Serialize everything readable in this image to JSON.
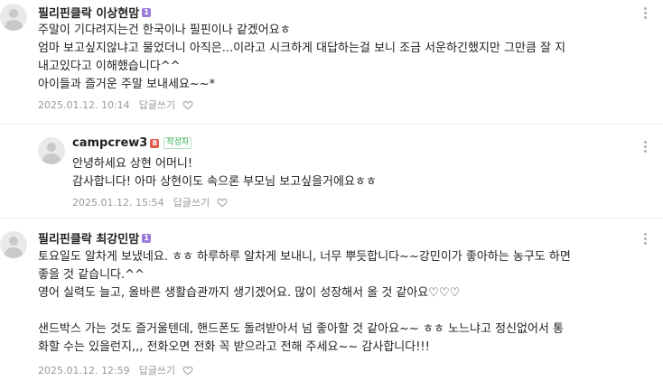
{
  "comments": [
    {
      "author": "필리핀클락 이상현맘",
      "level": "1",
      "text": "주말이 기다려지는건 한국이나 필핀이나 같겠어요ㅎ\n엄마 보고싶지않냐고 물었더니 아직은...이라고 시크하게 대답하는걸 보니 조금 서운하긴했지만 그만큼 잘 지\n내고있다고 이해했습니다^^\n아이들과 즐거운 주말 보내세요~~*",
      "date": "2025.01.12. 10:14",
      "reply_label": "답글쓰기"
    },
    {
      "author": "campcrew3",
      "level": "8",
      "writer_badge": "작성자",
      "text": "안녕하세요 상현 어머니!\n감사합니다! 아마 상현이도 속으론 부모님 보고싶을거에요ㅎㅎ",
      "date": "2025.01.12. 15:54",
      "reply_label": "답글쓰기"
    },
    {
      "author": "필리핀클락 최강민맘",
      "level": "1",
      "text": "토요일도 알차게 보냈네요. ㅎㅎ 하루하루 알차게 보내니, 너무 뿌듯합니다~~강민이가 좋아하는 농구도 하면\n좋을 것 같습니다.^^\n영어 실력도 늘고, 올바른 생활습관까지 생기겠어요. 많이 성장해서 올 것 같아요♡♡♡\n\n샌드박스 가는 것도 즐거울텐데, 핸드폰도 돌려받아서 넘 좋아할 것 같아요~~ ㅎㅎ 노느냐고 정신없어서 통\n화할 수는 있을런지,,, 전화오면 전화 꼭 받으라고 전해 주세요~~ 감사합니다!!!",
      "date": "2025.01.12. 12:59",
      "reply_label": "답글쓰기"
    }
  ]
}
